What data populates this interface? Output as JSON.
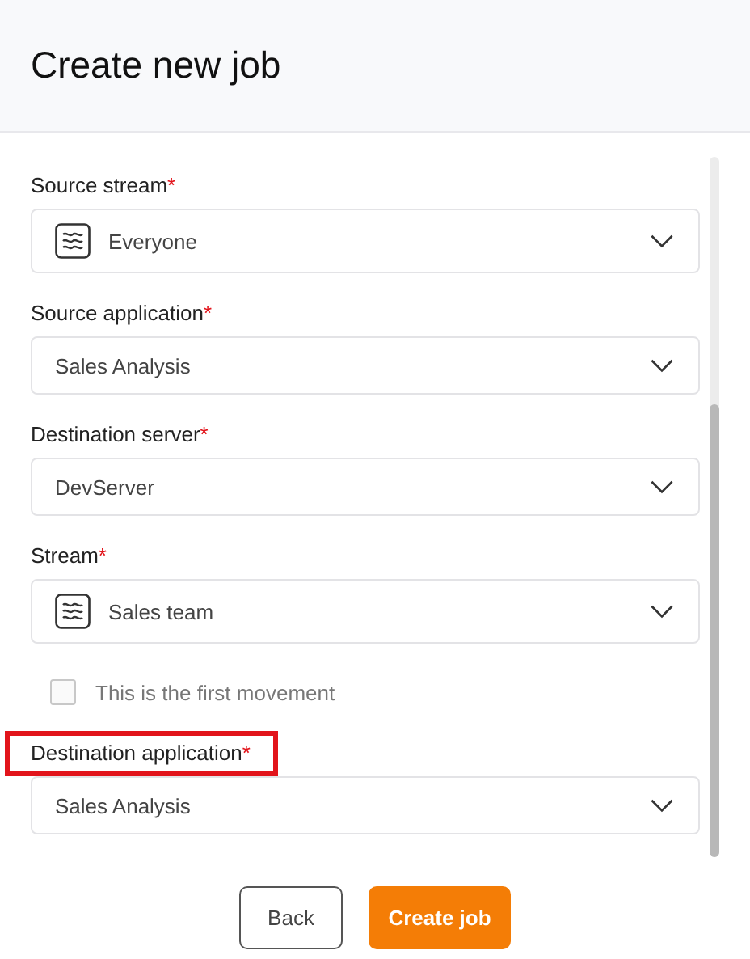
{
  "header": {
    "title": "Create new job"
  },
  "fields": [
    {
      "kind": "stream-select",
      "label": "Source stream",
      "required_mark": "*",
      "value": "Everyone",
      "highlighted": false
    },
    {
      "kind": "select",
      "label": "Source application",
      "required_mark": "*",
      "value": "Sales Analysis",
      "highlighted": false
    },
    {
      "kind": "select",
      "label": "Destination server",
      "required_mark": "*",
      "value": "DevServer",
      "highlighted": false
    },
    {
      "kind": "stream-select",
      "label": "Stream",
      "required_mark": "*",
      "value": "Sales team",
      "highlighted": false
    },
    {
      "kind": "checkbox",
      "label": "This is the first movement",
      "checked": false,
      "disabled": true
    },
    {
      "kind": "select",
      "label": "Destination application",
      "required_mark": "*",
      "value": "Sales Analysis",
      "highlighted": true
    }
  ],
  "buttons": [
    {
      "label": "Back",
      "kind": "secondary"
    },
    {
      "label": "Create job",
      "kind": "primary"
    }
  ]
}
